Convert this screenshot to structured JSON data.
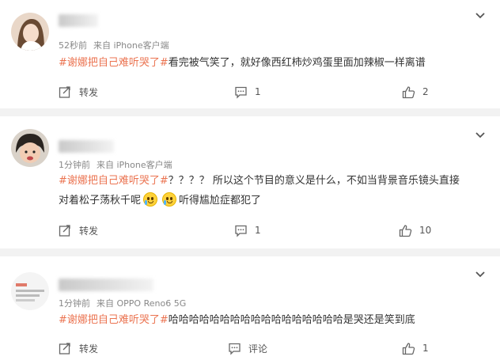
{
  "posts": [
    {
      "username": "▇▇▇▇▇",
      "time": "52秒前",
      "source": "来自 iPhone客户端",
      "tag": "#谢娜把自己难听哭了#",
      "text_line1": "看完被气笑了，就好像西红柿炒鸡蛋里面加辣椒一样离谱",
      "text_line2": "",
      "text_line2_after_emoji": "",
      "repost_label": "转发",
      "comment_count": "1",
      "like_count": "2"
    },
    {
      "username": "▇▇▇▇▇▇▇",
      "time": "1分钟前",
      "source": "来自 iPhone客户端",
      "tag": "#谢娜把自己难听哭了#",
      "text_line1": "？？？？ 所以这个节目的意义是什么，不如当背景音乐镜头直接",
      "text_line2": "对着松子荡秋千呢",
      "text_line2_after_emoji": "听得尴尬症都犯了",
      "repost_label": "转发",
      "comment_count": "1",
      "like_count": "10"
    },
    {
      "username": "▇▇▇▇▇▇▇▇▇▇▇▇",
      "time": "1分钟前",
      "source": "来自 OPPO Reno6 5G",
      "tag": "#谢娜把自己难听哭了#",
      "text_line1": "哈哈哈哈哈哈哈哈哈哈哈哈哈哈哈哈哈是哭还是笑到底",
      "text_line2": "",
      "text_line2_after_emoji": "",
      "repost_label": "转发",
      "comment_label": "评论",
      "like_count": "1"
    }
  ],
  "icons": {
    "repost": "repost-icon",
    "comment": "comment-icon",
    "like": "like-icon",
    "more": "chevron-down-icon",
    "emoji": "crying-face-emoji"
  },
  "colors": {
    "topic_tag": "#eb7350",
    "meta_text": "#888888",
    "separator": "#f2f2f2"
  }
}
